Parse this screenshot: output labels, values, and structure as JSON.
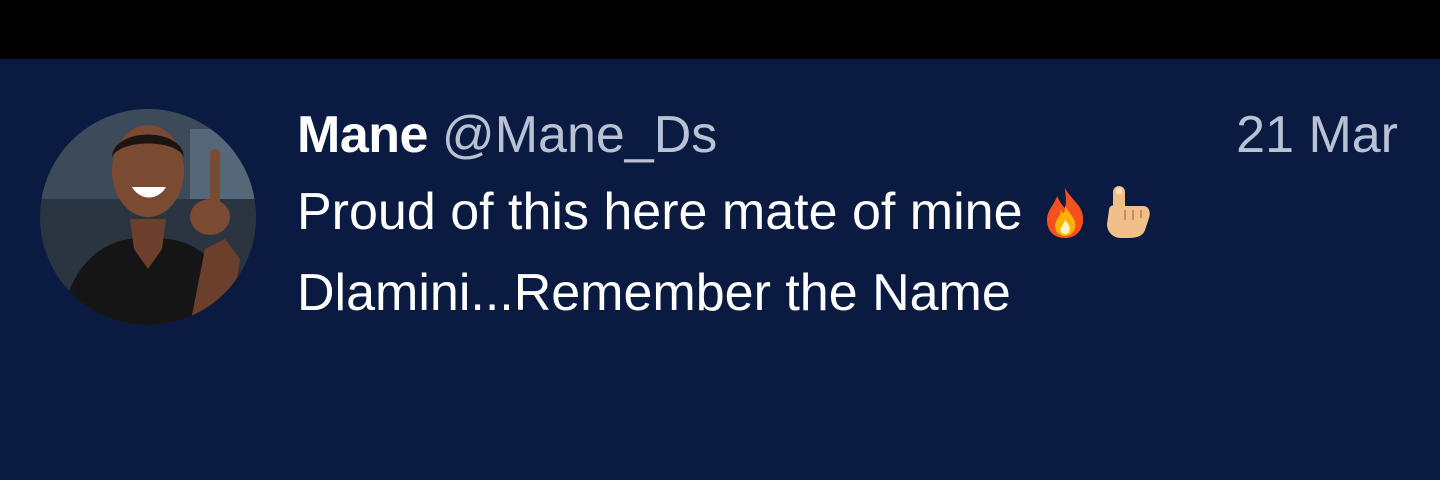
{
  "tweet": {
    "display_name": "Mane",
    "handle": "@Mane_Ds",
    "date": "21 Mar",
    "text_line1": "Proud of this here mate of mine",
    "text_line2": "Dlamini...Remember the Name",
    "emojis": [
      "fire-icon",
      "pointing-hand-icon"
    ]
  },
  "colors": {
    "top_bar": "#000000",
    "background": "#0a1a40",
    "name": "#ffffff",
    "muted": "#b8c2d3"
  }
}
